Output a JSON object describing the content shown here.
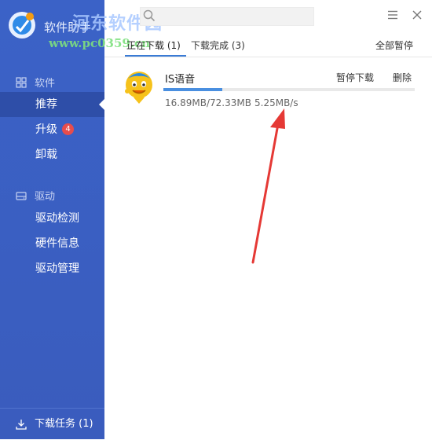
{
  "app": {
    "title": "软件助手",
    "watermark_text": "河东软件园",
    "watermark_url": "www.pc0359.cn"
  },
  "sidebar": {
    "software_section": "软件",
    "software_items": [
      {
        "label": "推荐",
        "active": true
      },
      {
        "label": "升级",
        "badge": "4"
      },
      {
        "label": "卸载"
      }
    ],
    "driver_section": "驱动",
    "driver_items": [
      {
        "label": "驱动检测"
      },
      {
        "label": "硬件信息"
      },
      {
        "label": "驱动管理"
      }
    ],
    "download_task": "下载任务 (1)"
  },
  "tabs": {
    "downloading": "正在下载 (1)",
    "completed": "下载完成 (3)",
    "pause_all": "全部暂停"
  },
  "download": {
    "name": "IS语音",
    "pause_label": "暂停下载",
    "delete_label": "删除",
    "size": "16.89MB/72.33MB",
    "speed": "5.25MB/s",
    "progress": 0.233
  },
  "colors": {
    "sidebar": "#3a5fc1",
    "accent": "#3a7bd5",
    "badge": "#e74c4c",
    "arrow": "#e53935"
  }
}
